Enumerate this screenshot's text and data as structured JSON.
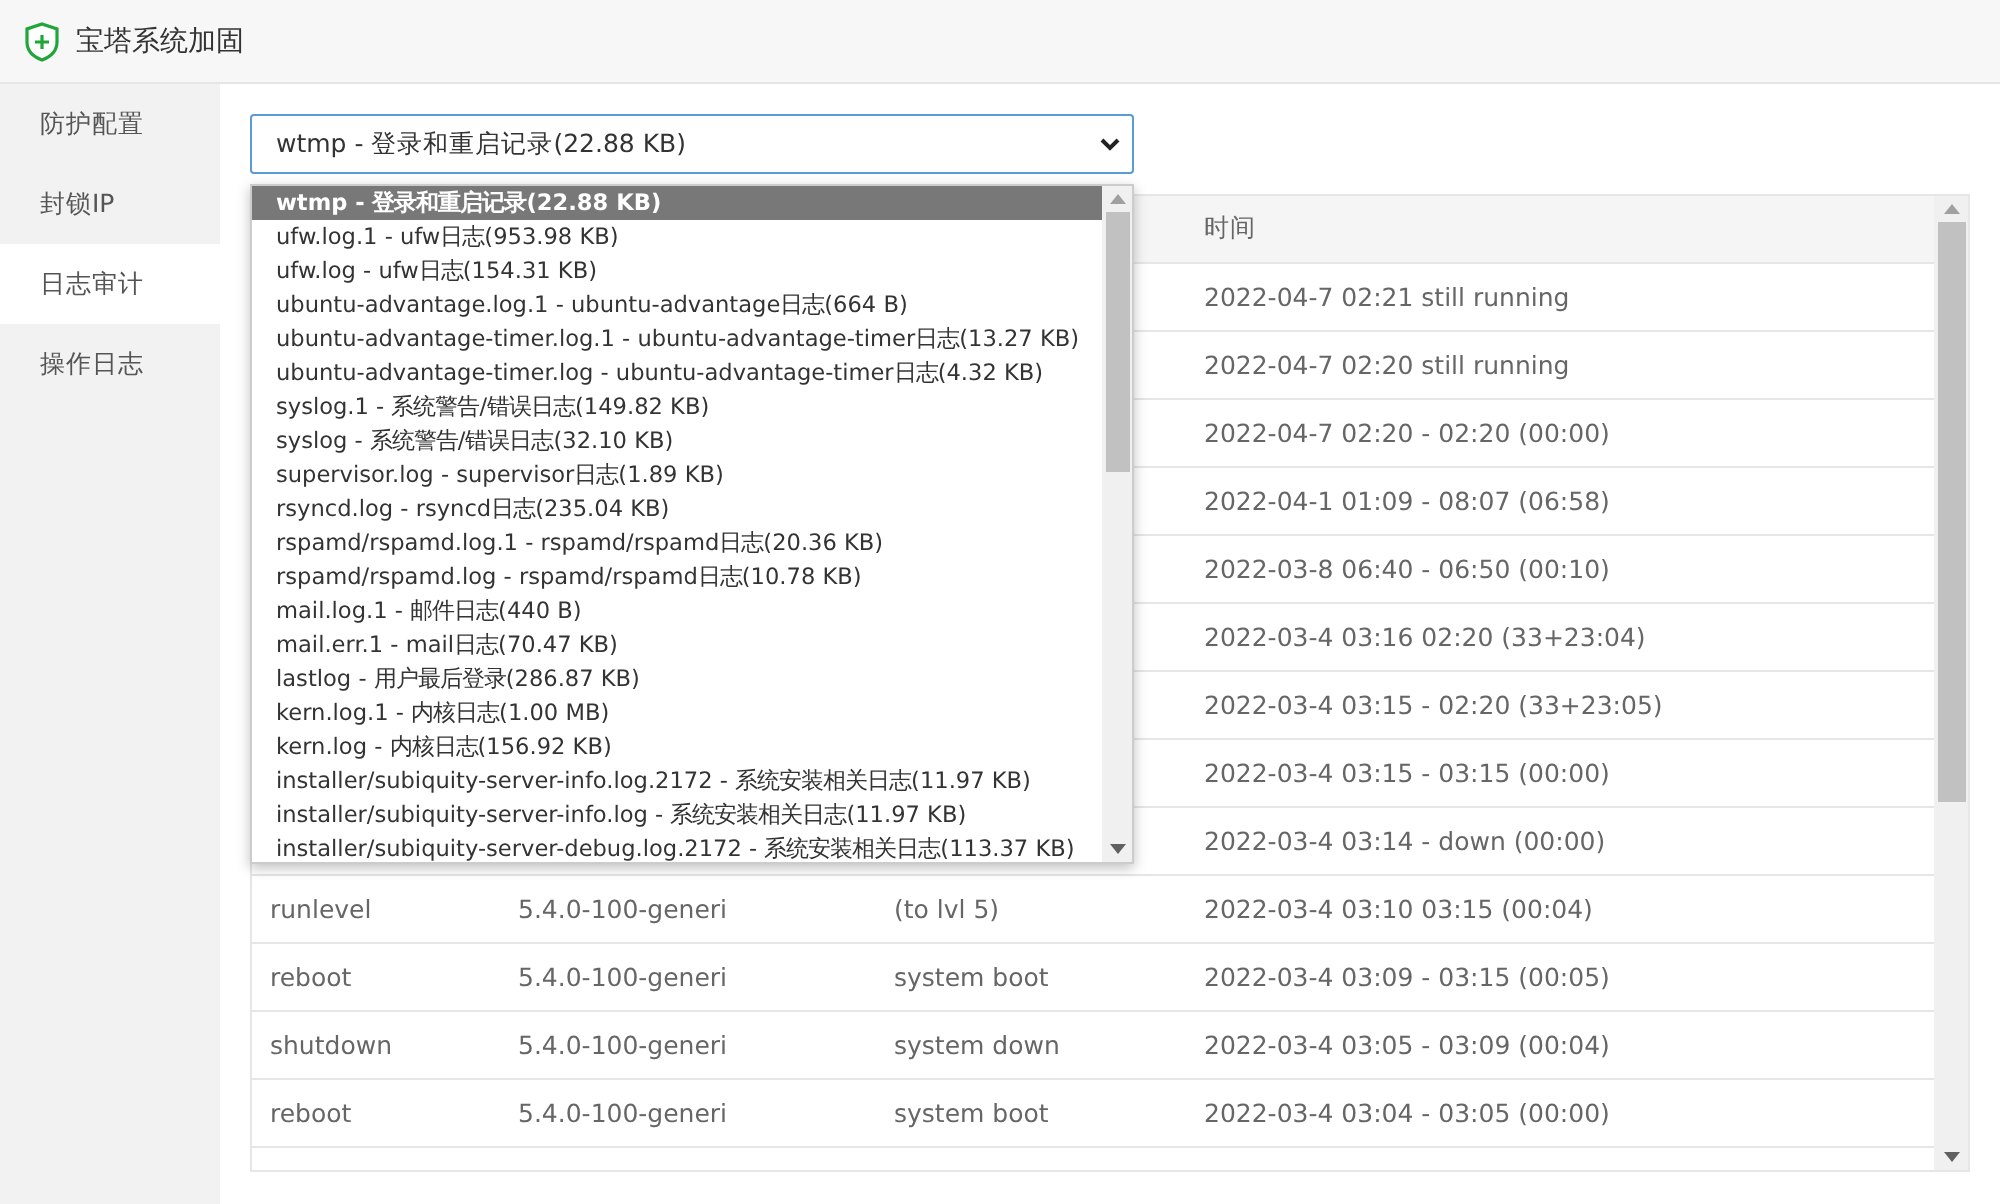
{
  "window": {
    "title": "宝塔系统加固"
  },
  "sidebar": {
    "items": [
      {
        "label": "防护配置",
        "selected": false
      },
      {
        "label": "封锁IP",
        "selected": false
      },
      {
        "label": "日志审计",
        "selected": true
      },
      {
        "label": "操作日志",
        "selected": false
      }
    ]
  },
  "log_select": {
    "value": "wtmp - 登录和重启记录(22.88 KB)",
    "options": [
      {
        "label": "wtmp - 登录和重启记录(22.88 KB)",
        "selected": true
      },
      {
        "label": "ufw.log.1 - ufw日志(953.98 KB)",
        "selected": false
      },
      {
        "label": "ufw.log - ufw日志(154.31 KB)",
        "selected": false
      },
      {
        "label": "ubuntu-advantage.log.1 - ubuntu-advantage日志(664 B)",
        "selected": false
      },
      {
        "label": "ubuntu-advantage-timer.log.1 - ubuntu-advantage-timer日志(13.27 KB)",
        "selected": false
      },
      {
        "label": "ubuntu-advantage-timer.log - ubuntu-advantage-timer日志(4.32 KB)",
        "selected": false
      },
      {
        "label": "syslog.1 - 系统警告/错误日志(149.82 KB)",
        "selected": false
      },
      {
        "label": "syslog - 系统警告/错误日志(32.10 KB)",
        "selected": false
      },
      {
        "label": "supervisor.log - supervisor日志(1.89 KB)",
        "selected": false
      },
      {
        "label": "rsyncd.log - rsyncd日志(235.04 KB)",
        "selected": false
      },
      {
        "label": "rspamd/rspamd.log.1 - rspamd/rspamd日志(20.36 KB)",
        "selected": false
      },
      {
        "label": "rspamd/rspamd.log - rspamd/rspamd日志(10.78 KB)",
        "selected": false
      },
      {
        "label": "mail.log.1 - 邮件日志(440 B)",
        "selected": false
      },
      {
        "label": "mail.err.1 - mail日志(70.47 KB)",
        "selected": false
      },
      {
        "label": "lastlog - 用户最后登录(286.87 KB)",
        "selected": false
      },
      {
        "label": "kern.log.1 - 内核日志(1.00 MB)",
        "selected": false
      },
      {
        "label": "kern.log - 内核日志(156.92 KB)",
        "selected": false
      },
      {
        "label": "installer/subiquity-server-info.log.2172 - 系统安装相关日志(11.97 KB)",
        "selected": false
      },
      {
        "label": "installer/subiquity-server-info.log - 系统安装相关日志(11.97 KB)",
        "selected": false
      },
      {
        "label": "installer/subiquity-server-debug.log.2172 - 系统安装相关日志(113.37 KB)",
        "selected": false
      }
    ]
  },
  "table": {
    "columns": {
      "column_4": "时间"
    },
    "rows": [
      {
        "column_4": "2022-04-7 02:21 still running"
      },
      {
        "column_4": "2022-04-7 02:20 still running"
      },
      {
        "column_4": "2022-04-7 02:20 - 02:20 (00:00)"
      },
      {
        "column_4": "2022-04-1 01:09 - 08:07 (06:58)"
      },
      {
        "column_4": "2022-03-8 06:40 - 06:50 (00:10)"
      },
      {
        "column_4": "2022-03-4 03:16 02:20 (33+23:04)"
      },
      {
        "column_4": "2022-03-4 03:15 - 02:20 (33+23:05)"
      },
      {
        "column_4": "2022-03-4 03:15 - 03:15 (00:00)"
      },
      {
        "column_4": "2022-03-4 03:14 - down (00:00)"
      },
      {
        "column_1": "runlevel",
        "column_2": "5.4.0-100-generi",
        "column_3": "(to lvl 5)",
        "column_4": "2022-03-4 03:10 03:15 (00:04)"
      },
      {
        "column_1": "reboot",
        "column_2": "5.4.0-100-generi",
        "column_3": "system boot",
        "column_4": "2022-03-4 03:09 - 03:15 (00:05)"
      },
      {
        "column_1": "shutdown",
        "column_2": "5.4.0-100-generi",
        "column_3": "system down",
        "column_4": "2022-03-4 03:05 - 03:09 (00:04)"
      },
      {
        "column_1": "reboot",
        "column_2": "5.4.0-100-generi",
        "column_3": "system boot",
        "column_4": "2022-03-4 03:04 - 03:05 (00:00)"
      }
    ]
  }
}
